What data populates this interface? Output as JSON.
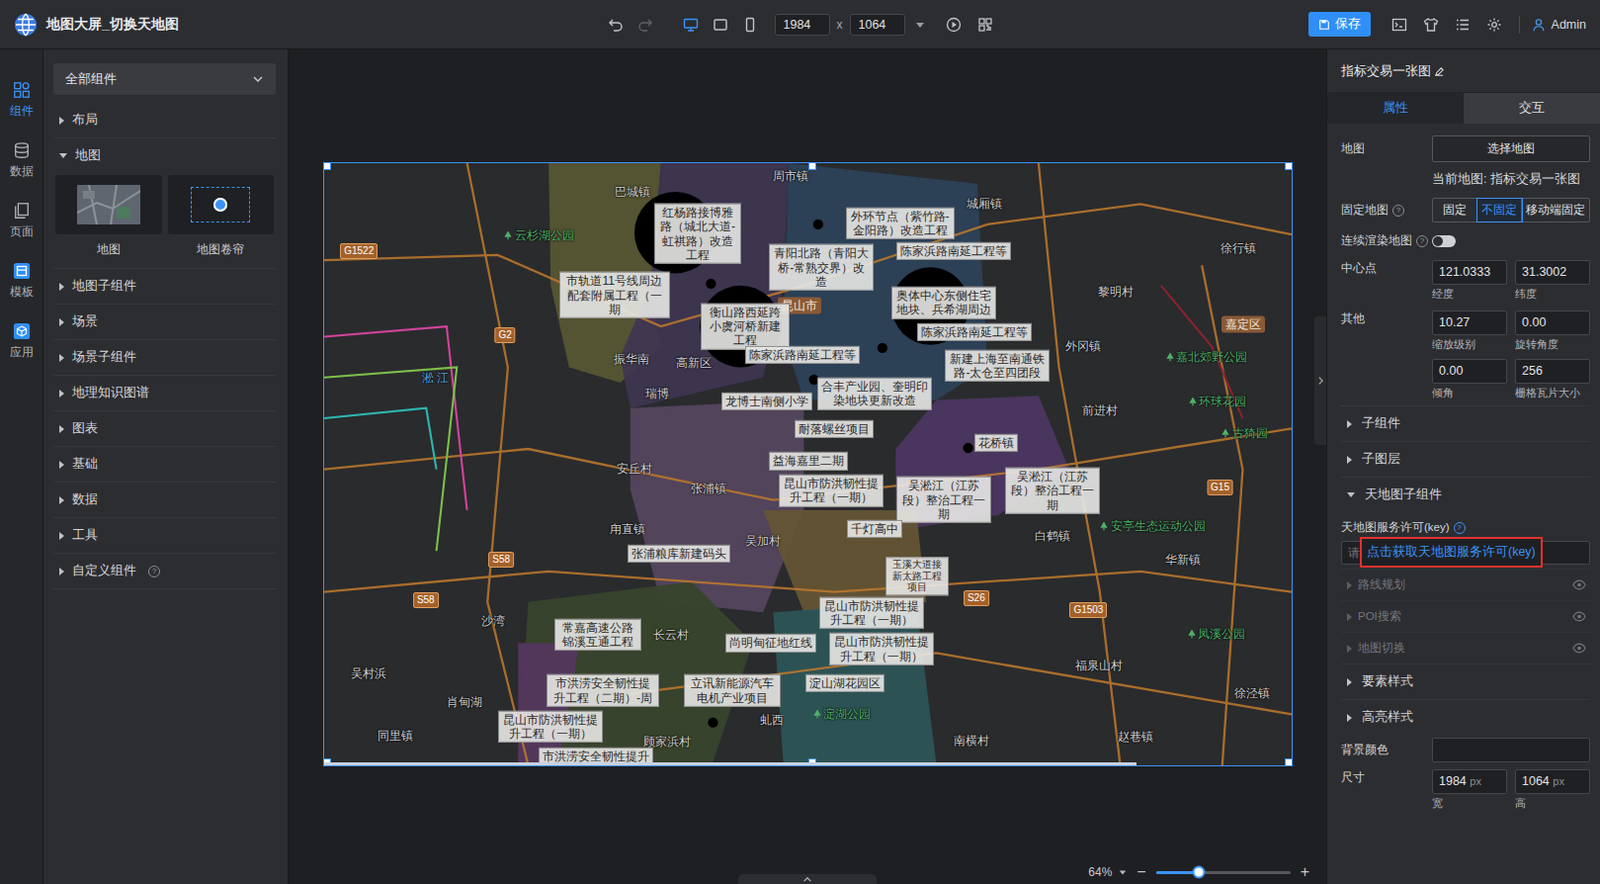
{
  "app": {
    "title": "地图大屏_切换天地图"
  },
  "toolbar": {
    "history": [
      {
        "kind": "undo",
        "disabled": false
      },
      {
        "kind": "redo",
        "disabled": true
      }
    ],
    "devices": [
      {
        "kind": "desktop",
        "selected": true
      },
      {
        "kind": "tablet",
        "selected": false
      },
      {
        "kind": "phone",
        "selected": false
      }
    ],
    "width": "1984",
    "separator": "x",
    "height": "1064",
    "save": "保存",
    "user": "Admin"
  },
  "rail": [
    {
      "label": "组件",
      "kind": "component",
      "selected": true
    },
    {
      "label": "数据",
      "kind": "data",
      "selected": false
    },
    {
      "label": "页面",
      "kind": "page",
      "selected": false
    },
    {
      "label": "模板",
      "kind": "template",
      "selected": false
    },
    {
      "label": "应用",
      "kind": "app",
      "selected": false
    }
  ],
  "component_panel": {
    "filter": "全部组件",
    "groups": [
      {
        "label": "布局",
        "expanded": false
      },
      {
        "label": "地图",
        "expanded": true,
        "items": [
          {
            "label": "地图",
            "kind": "map"
          },
          {
            "label": "地图卷帘",
            "kind": "swipe"
          }
        ]
      },
      {
        "label": "地图子组件",
        "expanded": false
      },
      {
        "label": "场景",
        "expanded": false
      },
      {
        "label": "场景子组件",
        "expanded": false
      },
      {
        "label": "地理知识图谱",
        "expanded": false
      },
      {
        "label": "图表",
        "expanded": false
      },
      {
        "label": "基础",
        "expanded": false
      },
      {
        "label": "数据",
        "expanded": false
      },
      {
        "label": "工具",
        "expanded": false
      },
      {
        "label": "自定义组件",
        "expanded": false,
        "help": "?"
      }
    ]
  },
  "map": {
    "projects": [
      "红杨路接博雅路（城北大道-虹祺路）改造工程",
      "外环节点（紫竹路-金阳路）改造工程",
      "青阳北路（青阳大桥-常熟交界）改造",
      "陈家浜路南延工程等",
      "市轨道11号线周边配套附属工程（一期",
      "衡山路西延跨小虞河桥新建工程",
      "奥体中心东侧住宅地块、兵希湖周边",
      "陈家浜路南延工程等",
      "陈家浜路南延工程等",
      "新建上海至南通铁路-太仓至四团段",
      "合丰产业园、奎明印染地块更新改造",
      "龙博士南侧小学",
      "耐落螺丝项目",
      "益海嘉里二期",
      "花桥镇",
      "昆山市防洪韧性提升工程（一期）",
      "吴淞江（江苏段）整治工程一期",
      "吴淞江（江苏段）整治工程一期",
      "千灯高中",
      "张浦粮库新建码头",
      "玉溪大道接新太路工程项目",
      "昆山市防洪韧性提升工程（一期）",
      "常嘉高速公路锦溪互通工程",
      "尚明甸征地红线",
      "昆山市防洪韧性提升工程（一期）",
      "市洪涝安全韧性提升工程（二期）-周",
      "立讯新能源汽车电机产业项目",
      "淀山湖花园区",
      "昆山市防洪韧性提升工程（一期）",
      "市洪涝安全韧性提升"
    ],
    "places": [
      {
        "text": "巴城镇",
        "kind": "town"
      },
      {
        "text": "周市镇",
        "kind": "town"
      },
      {
        "text": "城厢镇",
        "kind": "town"
      },
      {
        "text": "徐行镇",
        "kind": "town"
      },
      {
        "text": "云杉湖公园",
        "kind": "park"
      },
      {
        "text": "黎明村",
        "kind": "town"
      },
      {
        "text": "嘉定区",
        "kind": "district"
      },
      {
        "text": "外冈镇",
        "kind": "town"
      },
      {
        "text": "前进村",
        "kind": "town"
      },
      {
        "text": "振华南",
        "kind": "town"
      },
      {
        "text": "高新区",
        "kind": "town"
      },
      {
        "text": "昆山市",
        "kind": "district"
      },
      {
        "text": "瑞博",
        "kind": "town"
      },
      {
        "text": "安丘村",
        "kind": "town"
      },
      {
        "text": "张浦镇",
        "kind": "town"
      },
      {
        "text": "甪直镇",
        "kind": "town"
      },
      {
        "text": "吴加村",
        "kind": "town"
      },
      {
        "text": "白鹤镇",
        "kind": "town"
      },
      {
        "text": "华新镇",
        "kind": "town"
      },
      {
        "text": "沙湾",
        "kind": "town"
      },
      {
        "text": "长云村",
        "kind": "town"
      },
      {
        "text": "吴村浜",
        "kind": "town"
      },
      {
        "text": "同里镇",
        "kind": "town"
      },
      {
        "text": "肖甸湖",
        "kind": "town"
      },
      {
        "text": "顾家浜村",
        "kind": "town"
      },
      {
        "text": "虬西",
        "kind": "town"
      },
      {
        "text": "南横村",
        "kind": "town"
      },
      {
        "text": "赵巷镇",
        "kind": "town"
      },
      {
        "text": "福泉山村",
        "kind": "town"
      },
      {
        "text": "徐泾镇",
        "kind": "town"
      },
      {
        "text": "安亭生态运动公园",
        "kind": "park"
      },
      {
        "text": "凤溪公园",
        "kind": "park"
      },
      {
        "text": "古猗园",
        "kind": "park"
      },
      {
        "text": "环球花园",
        "kind": "park"
      },
      {
        "text": "嘉北郊野公园",
        "kind": "park"
      },
      {
        "text": "淀湖公园",
        "kind": "park"
      },
      {
        "text": "淞 江",
        "kind": "water"
      }
    ],
    "roads": [
      "G1522",
      "G2",
      "G15",
      "S26",
      "G1503",
      "S58",
      "S58"
    ]
  },
  "zoom": {
    "reading": "64%",
    "minus": "−",
    "plus": "+",
    "level": 0.32
  },
  "inspector": {
    "title": "指标交易一张图",
    "tabs": [
      {
        "label": "属性",
        "selected": true
      },
      {
        "label": "交互",
        "selected": false
      }
    ],
    "map_label": "地图",
    "map_button": "选择地图",
    "current_map": "当前地图: 指标交易一张图",
    "fixed": {
      "label": "固定地图",
      "help": "?",
      "options": [
        {
          "label": "固定",
          "selected": false
        },
        {
          "label": "不固定",
          "selected": true
        },
        {
          "label": "移动端固定",
          "selected": false
        }
      ]
    },
    "continuous": {
      "label": "连续渲染地图",
      "help": "?",
      "on": false
    },
    "center": {
      "label": "中心点",
      "fields": [
        {
          "value": "121.0333",
          "caption": "经度"
        },
        {
          "value": "31.3002",
          "caption": "纬度"
        }
      ]
    },
    "other": {
      "label": "其他",
      "fields": [
        {
          "value": "10.27",
          "caption": "缩放级别"
        },
        {
          "value": "0.00",
          "caption": "旋转角度"
        },
        {
          "value": "0.00",
          "caption": "倾角"
        },
        {
          "value": "256",
          "caption": "栅格瓦片大小"
        }
      ]
    },
    "sections": [
      {
        "label": "子组件",
        "expanded": false
      },
      {
        "label": "子图层",
        "expanded": false
      }
    ],
    "tianditu": {
      "label": "天地图子组件",
      "expanded": true,
      "key_label": "天地图服务许可(key)",
      "help": "?",
      "placeholder": "请",
      "link": "点击获取天地图服务许可(key)",
      "highlighted": true,
      "items": [
        {
          "label": "路线规划",
          "disabled": true
        },
        {
          "label": "POI搜索",
          "disabled": true
        },
        {
          "label": "地图切换",
          "disabled": true
        }
      ]
    },
    "sections_after": [
      {
        "label": "要素样式",
        "expanded": false
      },
      {
        "label": "高亮样式",
        "expanded": false
      }
    ],
    "background": {
      "label": "背景颜色",
      "value": ""
    },
    "size": {
      "label": "尺寸",
      "fields": [
        {
          "value": "1984",
          "unit": "px",
          "caption": "宽"
        },
        {
          "value": "1064",
          "unit": "px",
          "caption": "高"
        }
      ]
    }
  }
}
